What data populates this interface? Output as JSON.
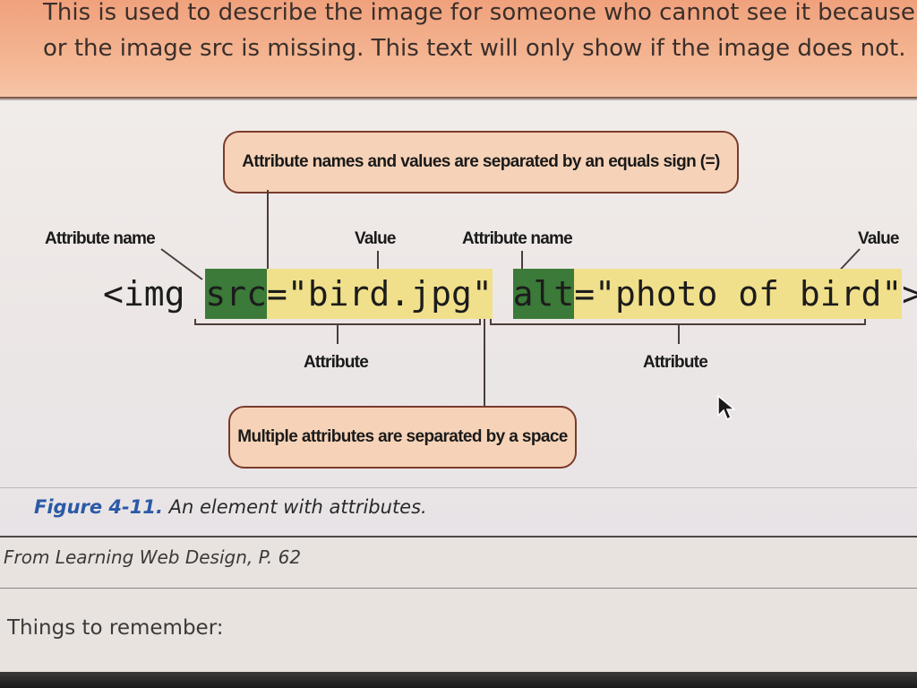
{
  "note": {
    "line1": "This is used to describe the image for someone who cannot see it because t",
    "line2": "or the image src is missing. This text will only show if the image does not."
  },
  "figure": {
    "callout_top": "Attribute names and values are separated by an equals sign (=)",
    "callout_bottom": "Multiple attributes are separated by a space",
    "labels": {
      "attr_name_left": "Attribute name",
      "value_left": "Value",
      "attr_name_right": "Attribute name",
      "value_right": "Value",
      "attribute_left": "Attribute",
      "attribute_right": "Attribute"
    },
    "code": {
      "open": "<img ",
      "src_name": "src",
      "eq1": "=",
      "src_value": "\"bird.jpg\"",
      "space": " ",
      "alt_name": "alt",
      "eq2": "=",
      "alt_value": "\"photo of bird\"",
      "close": ">"
    },
    "caption_number": "Figure 4-11.",
    "caption_text": "An element with attributes."
  },
  "source": "From Learning Web Design, P. 62",
  "things_to_remember": "Things to remember:",
  "colors": {
    "note_bg": "#f0a17c",
    "callout_bg": "#f6d3b8",
    "attr_name_highlight": "#3b7a38",
    "attr_value_highlight": "#f1e08b",
    "caption_number": "#2b5aa6"
  },
  "cursor_icon": "arrow-cursor-icon"
}
